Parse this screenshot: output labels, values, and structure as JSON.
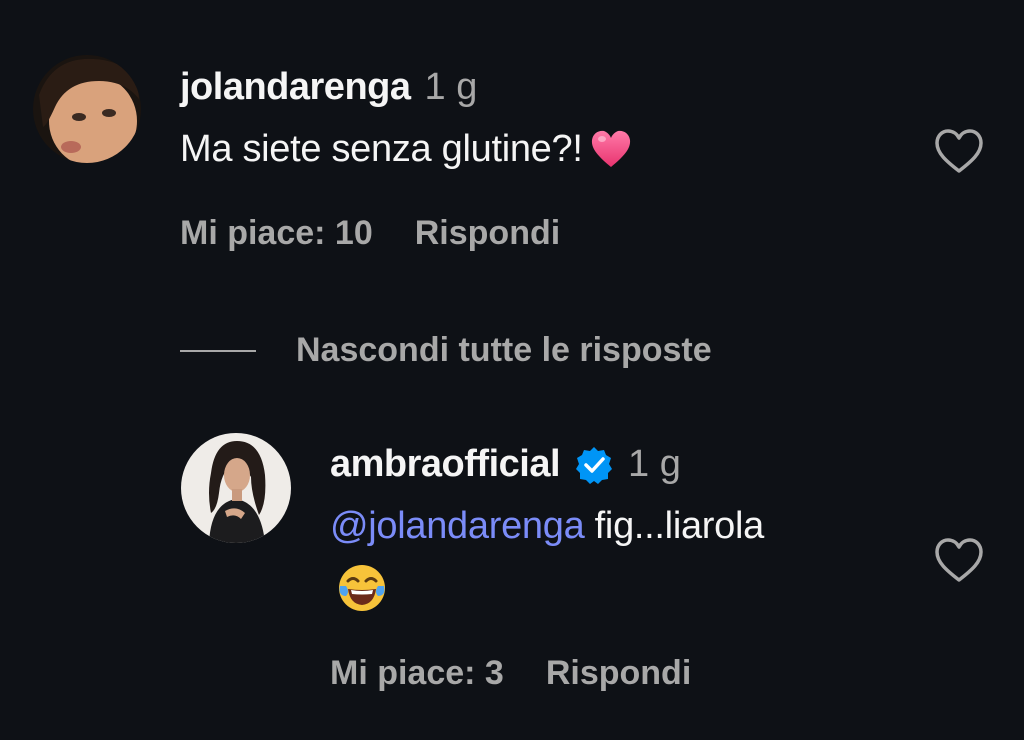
{
  "comment": {
    "username": "jolandarenga",
    "time": "1 g",
    "text": "Ma siete senza glutine?!",
    "text_emoji": "pink-heart",
    "likes_label": "Mi piace: 10",
    "reply_label": "Rispondi"
  },
  "hide_replies_label": "Nascondi tutte le risposte",
  "reply": {
    "username": "ambraofficial",
    "verified": true,
    "time": "1 g",
    "mention": "@jolandarenga",
    "text": " fig...liarola",
    "text_emoji": "face-with-tears-of-joy",
    "likes_label": "Mi piace: 3",
    "reply_label": "Rispondi"
  },
  "colors": {
    "background": "#0e1116",
    "primary_text": "#f5f5f5",
    "secondary_text": "#a8a8a8",
    "mention": "#7b8cf8",
    "verified_badge": "#0095f6"
  },
  "icons": {
    "like": "heart-outline-icon",
    "verified": "verified-badge-icon"
  }
}
